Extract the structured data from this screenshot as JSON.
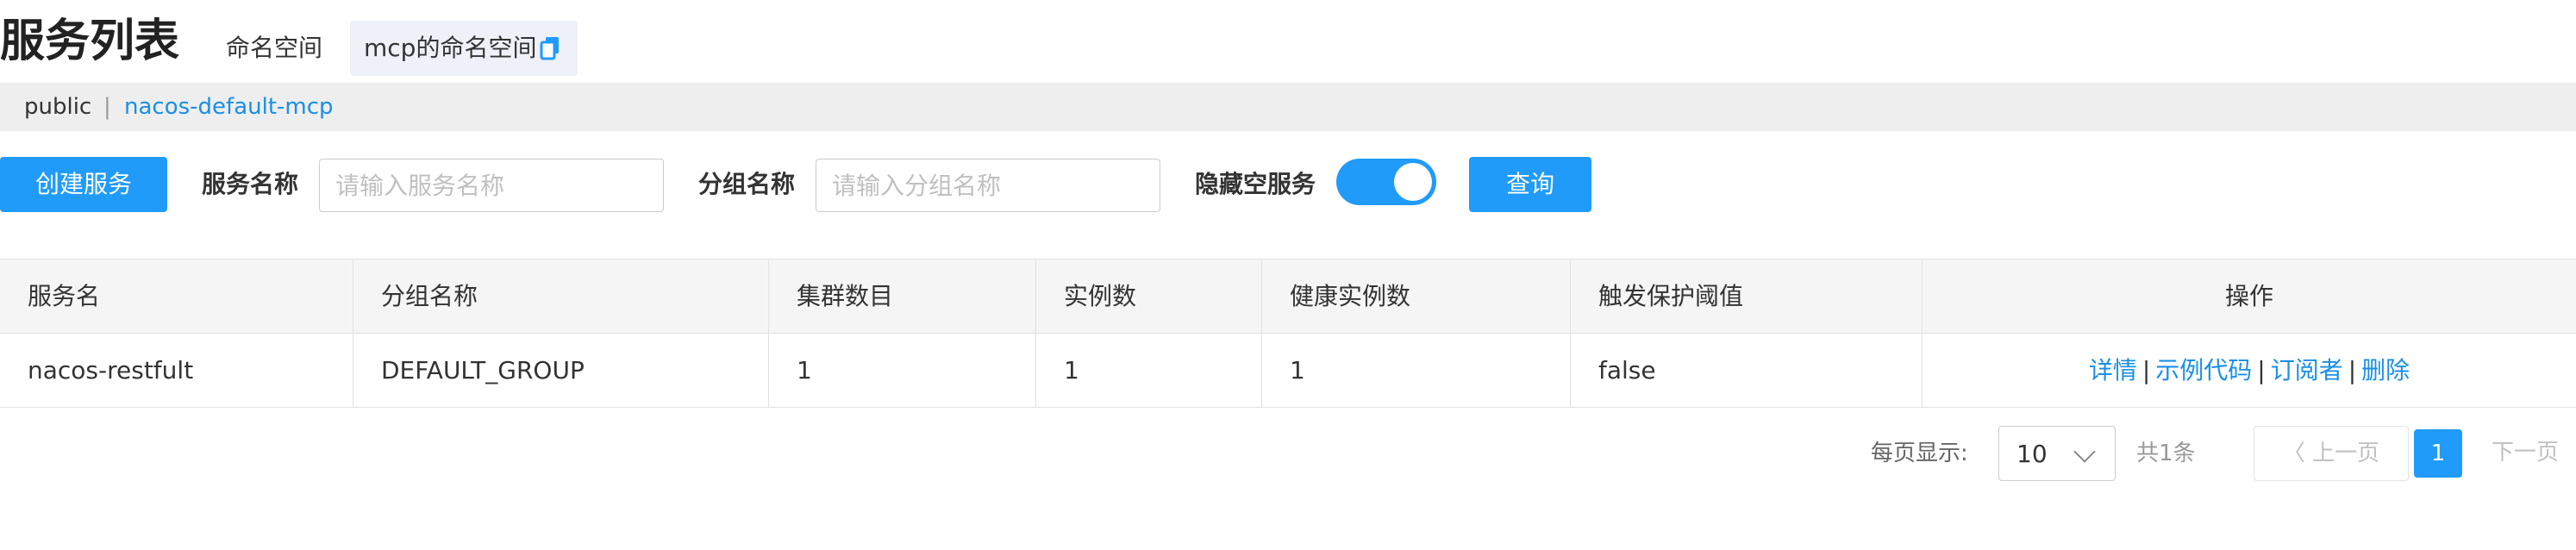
{
  "header": {
    "title": "服务列表",
    "namespace_label": "命名空间",
    "namespace_value": "mcp的命名空间"
  },
  "namespace_bar": {
    "items": [
      "public",
      "nacos-default-mcp"
    ],
    "separator": "|",
    "active_index": 1
  },
  "filters": {
    "create_button": "创建服务",
    "service_name_label": "服务名称",
    "service_name_placeholder": "请输入服务名称",
    "group_name_label": "分组名称",
    "group_name_placeholder": "请输入分组名称",
    "hide_empty_label": "隐藏空服务",
    "hide_empty_on": true,
    "query_button": "查询"
  },
  "table": {
    "columns": [
      "服务名",
      "分组名称",
      "集群数目",
      "实例数",
      "健康实例数",
      "触发保护阈值",
      "操作"
    ],
    "rows": [
      {
        "service_name": "nacos-restfult",
        "group_name": "DEFAULT_GROUP",
        "cluster_count": "1",
        "instance_count": "1",
        "healthy_instance_count": "1",
        "protect_threshold_triggered": "false",
        "actions": [
          "详情",
          "示例代码",
          "订阅者",
          "删除"
        ],
        "action_separator": "|"
      }
    ]
  },
  "pagination": {
    "page_size_label": "每页显示:",
    "page_size": "10",
    "total_label": "共1条",
    "prev_label": "〈 上一页",
    "current_page": "1",
    "next_label": "下一页"
  },
  "colors": {
    "primary": "#209bfa",
    "link": "#1a8fe6",
    "header_bg": "#f5f5f5",
    "namespace_bar_bg": "#eeeeee"
  }
}
